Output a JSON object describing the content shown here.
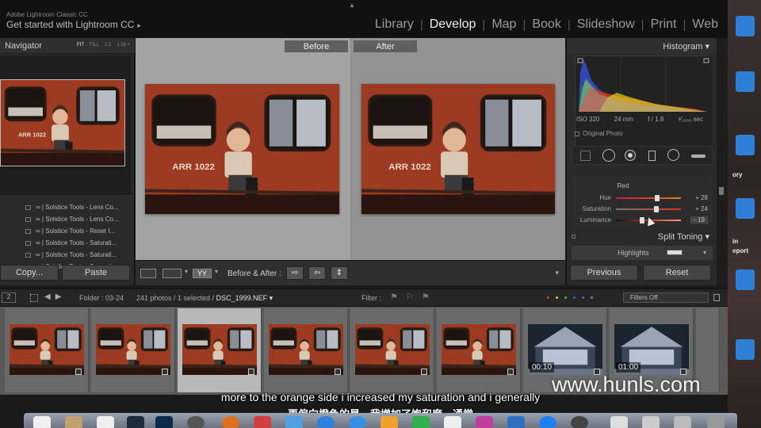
{
  "app": {
    "subtitle_small": "Adobe Lightroom Classic CC",
    "title": "Get started with Lightroom CC",
    "title_arrow": "▸",
    "collapse_glyph": "▲"
  },
  "modules": {
    "items": [
      "Library",
      "Develop",
      "Map",
      "Book",
      "Slideshow",
      "Print",
      "Web"
    ],
    "active": "Develop",
    "separator": "|"
  },
  "navigator": {
    "title": "Navigator",
    "zoom": [
      "FIT",
      "FILL",
      "1:1",
      "1:16 ÷"
    ]
  },
  "presets": [
    "Solstice Tools - Lens Co...",
    "Solstice Tools - Lens Co...",
    "Solstice Tools - Reset I...",
    "Solstice Tools - Saturati...",
    "Solstice Tools - Saturati...",
    "Solstice Tools - Saturati..."
  ],
  "preset_prefix": "∞ |",
  "left_buttons": {
    "copy": "Copy...",
    "paste": "Paste"
  },
  "view": {
    "before_label": "Before",
    "after_label": "After"
  },
  "toolbar": {
    "before_after_label": "Before & After :",
    "yy_label": "YY",
    "caret": "▾",
    "btn_copy_right": "⇨",
    "btn_copy_left": "⇦",
    "btn_swap": "⇕"
  },
  "photo_caption": "ARR 1022",
  "histogram": {
    "title": "Histogram",
    "iso": "ISO 320",
    "focal": "24 mm",
    "aperture": "f / 1.8",
    "shutter": "¹⁄₁₀₀₀ sec",
    "original_photo": "Original Photo"
  },
  "hsl": {
    "color_label": "Red",
    "rows": [
      {
        "label": "Hue",
        "value": "+ 28",
        "amount": 28
      },
      {
        "label": "Saturation",
        "value": "+ 24",
        "amount": 24
      },
      {
        "label": "Luminance",
        "value": "- 19",
        "amount": -19
      }
    ]
  },
  "split_toning": {
    "title": "Split Toning",
    "highlights": "Highlights"
  },
  "right_buttons": {
    "previous": "Previous",
    "reset": "Reset"
  },
  "filmstrip_bar": {
    "page": "2",
    "folder": "Folder : 03-24",
    "count_prefix": "241 photos / 1 selected /",
    "filename": "DSC_1999.NEF ▾",
    "filter_label": "Filter :",
    "filters_off": "Filters Off"
  },
  "filmstrip": [
    {
      "kind": "train",
      "selected": false,
      "duration": ""
    },
    {
      "kind": "train",
      "selected": false,
      "duration": ""
    },
    {
      "kind": "train",
      "selected": true,
      "duration": ""
    },
    {
      "kind": "train",
      "selected": false,
      "duration": ""
    },
    {
      "kind": "train",
      "selected": false,
      "duration": ""
    },
    {
      "kind": "train",
      "selected": false,
      "duration": ""
    },
    {
      "kind": "building",
      "selected": false,
      "duration": "00:10"
    },
    {
      "kind": "building",
      "selected": false,
      "duration": "01:00"
    }
  ],
  "subtitles": {
    "english": "more to the orange side i increased my saturation and i generally",
    "chinese": "更偏向橙色的是，我增加了饱和度，通常"
  },
  "watermark": "www.hunls.com",
  "desktop_labels": [
    "ory",
    "in",
    "eport"
  ],
  "colors": {
    "accent_red": "#a63a20",
    "panel_bg": "#2a2a2a",
    "canvas_bg": "#8f8f8f",
    "filmstrip_bg": "#5a5a5a"
  }
}
